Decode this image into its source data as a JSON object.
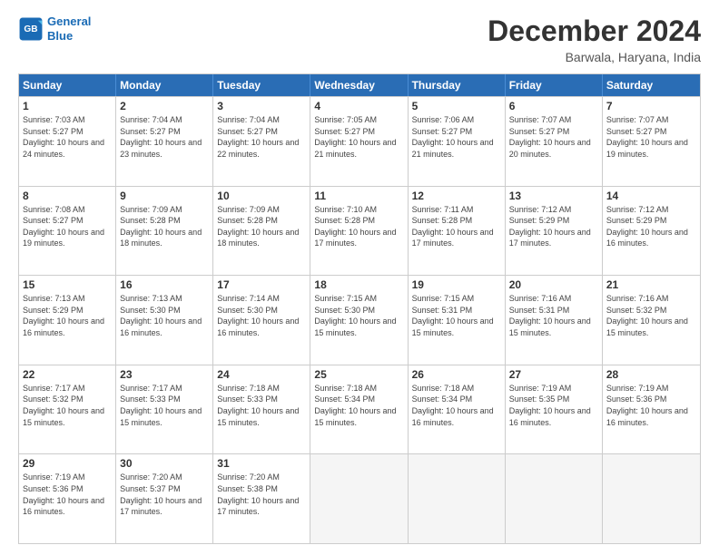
{
  "logo": {
    "line1": "General",
    "line2": "Blue"
  },
  "title": "December 2024",
  "subtitle": "Barwala, Haryana, India",
  "days": [
    "Sunday",
    "Monday",
    "Tuesday",
    "Wednesday",
    "Thursday",
    "Friday",
    "Saturday"
  ],
  "weeks": [
    [
      {
        "day": 1,
        "sunrise": "7:03 AM",
        "sunset": "5:27 PM",
        "daylight": "10 hours and 24 minutes."
      },
      {
        "day": 2,
        "sunrise": "7:04 AM",
        "sunset": "5:27 PM",
        "daylight": "10 hours and 23 minutes."
      },
      {
        "day": 3,
        "sunrise": "7:04 AM",
        "sunset": "5:27 PM",
        "daylight": "10 hours and 22 minutes."
      },
      {
        "day": 4,
        "sunrise": "7:05 AM",
        "sunset": "5:27 PM",
        "daylight": "10 hours and 21 minutes."
      },
      {
        "day": 5,
        "sunrise": "7:06 AM",
        "sunset": "5:27 PM",
        "daylight": "10 hours and 21 minutes."
      },
      {
        "day": 6,
        "sunrise": "7:07 AM",
        "sunset": "5:27 PM",
        "daylight": "10 hours and 20 minutes."
      },
      {
        "day": 7,
        "sunrise": "7:07 AM",
        "sunset": "5:27 PM",
        "daylight": "10 hours and 19 minutes."
      }
    ],
    [
      {
        "day": 8,
        "sunrise": "7:08 AM",
        "sunset": "5:27 PM",
        "daylight": "10 hours and 19 minutes."
      },
      {
        "day": 9,
        "sunrise": "7:09 AM",
        "sunset": "5:28 PM",
        "daylight": "10 hours and 18 minutes."
      },
      {
        "day": 10,
        "sunrise": "7:09 AM",
        "sunset": "5:28 PM",
        "daylight": "10 hours and 18 minutes."
      },
      {
        "day": 11,
        "sunrise": "7:10 AM",
        "sunset": "5:28 PM",
        "daylight": "10 hours and 17 minutes."
      },
      {
        "day": 12,
        "sunrise": "7:11 AM",
        "sunset": "5:28 PM",
        "daylight": "10 hours and 17 minutes."
      },
      {
        "day": 13,
        "sunrise": "7:12 AM",
        "sunset": "5:29 PM",
        "daylight": "10 hours and 17 minutes."
      },
      {
        "day": 14,
        "sunrise": "7:12 AM",
        "sunset": "5:29 PM",
        "daylight": "10 hours and 16 minutes."
      }
    ],
    [
      {
        "day": 15,
        "sunrise": "7:13 AM",
        "sunset": "5:29 PM",
        "daylight": "10 hours and 16 minutes."
      },
      {
        "day": 16,
        "sunrise": "7:13 AM",
        "sunset": "5:30 PM",
        "daylight": "10 hours and 16 minutes."
      },
      {
        "day": 17,
        "sunrise": "7:14 AM",
        "sunset": "5:30 PM",
        "daylight": "10 hours and 16 minutes."
      },
      {
        "day": 18,
        "sunrise": "7:15 AM",
        "sunset": "5:30 PM",
        "daylight": "10 hours and 15 minutes."
      },
      {
        "day": 19,
        "sunrise": "7:15 AM",
        "sunset": "5:31 PM",
        "daylight": "10 hours and 15 minutes."
      },
      {
        "day": 20,
        "sunrise": "7:16 AM",
        "sunset": "5:31 PM",
        "daylight": "10 hours and 15 minutes."
      },
      {
        "day": 21,
        "sunrise": "7:16 AM",
        "sunset": "5:32 PM",
        "daylight": "10 hours and 15 minutes."
      }
    ],
    [
      {
        "day": 22,
        "sunrise": "7:17 AM",
        "sunset": "5:32 PM",
        "daylight": "10 hours and 15 minutes."
      },
      {
        "day": 23,
        "sunrise": "7:17 AM",
        "sunset": "5:33 PM",
        "daylight": "10 hours and 15 minutes."
      },
      {
        "day": 24,
        "sunrise": "7:18 AM",
        "sunset": "5:33 PM",
        "daylight": "10 hours and 15 minutes."
      },
      {
        "day": 25,
        "sunrise": "7:18 AM",
        "sunset": "5:34 PM",
        "daylight": "10 hours and 15 minutes."
      },
      {
        "day": 26,
        "sunrise": "7:18 AM",
        "sunset": "5:34 PM",
        "daylight": "10 hours and 16 minutes."
      },
      {
        "day": 27,
        "sunrise": "7:19 AM",
        "sunset": "5:35 PM",
        "daylight": "10 hours and 16 minutes."
      },
      {
        "day": 28,
        "sunrise": "7:19 AM",
        "sunset": "5:36 PM",
        "daylight": "10 hours and 16 minutes."
      }
    ],
    [
      {
        "day": 29,
        "sunrise": "7:19 AM",
        "sunset": "5:36 PM",
        "daylight": "10 hours and 16 minutes."
      },
      {
        "day": 30,
        "sunrise": "7:20 AM",
        "sunset": "5:37 PM",
        "daylight": "10 hours and 17 minutes."
      },
      {
        "day": 31,
        "sunrise": "7:20 AM",
        "sunset": "5:38 PM",
        "daylight": "10 hours and 17 minutes."
      },
      null,
      null,
      null,
      null
    ]
  ]
}
